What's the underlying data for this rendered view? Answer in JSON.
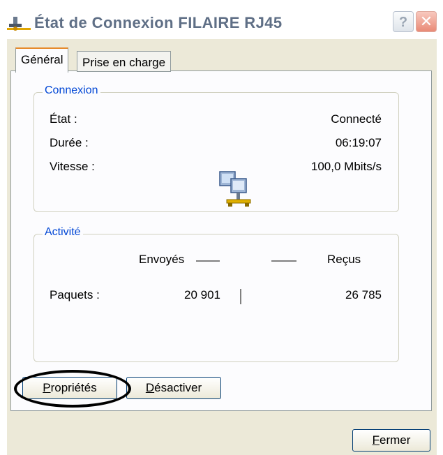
{
  "window": {
    "title": "État de Connexion FILAIRE RJ45",
    "help_label": "?",
    "close_label": "✕"
  },
  "tabs": [
    {
      "label": "Général",
      "active": true
    },
    {
      "label": "Prise en charge",
      "active": false
    }
  ],
  "connexion": {
    "group_title": "Connexion",
    "rows": [
      {
        "label": "État :",
        "value": "Connecté"
      },
      {
        "label": "Durée :",
        "value": "06:19:07"
      },
      {
        "label": "Vitesse :",
        "value": "100,0 Mbits/s"
      }
    ]
  },
  "activite": {
    "group_title": "Activité",
    "sent_label": "Envoyés",
    "received_label": "Reçus",
    "packets_label": "Paquets :",
    "packets_sent": "20 901",
    "packets_received": "26 785"
  },
  "buttons": {
    "properties_first": "P",
    "properties_rest": "ropriétés",
    "disable_first": "D",
    "disable_rest": "ésactiver",
    "close_first": "F",
    "close_rest": "ermer"
  },
  "icons": {
    "title": "network-connection-icon",
    "activity": "network-activity-icon"
  },
  "colors": {
    "group_title": "#0046d5",
    "active_tab_accent": "#e68b2c",
    "dialog_background": "#ece9d8",
    "title_text": "#5f6f86"
  }
}
